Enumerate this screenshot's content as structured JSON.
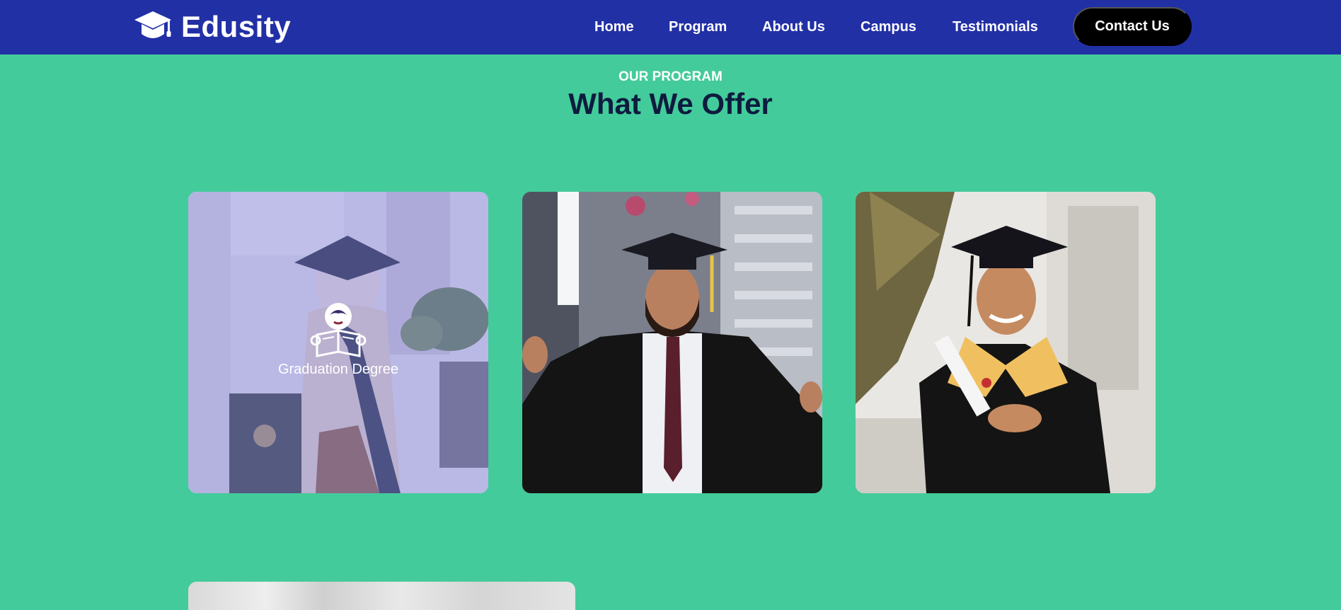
{
  "brand": {
    "name": "Edusity"
  },
  "nav": {
    "items": [
      {
        "label": "Home"
      },
      {
        "label": "Program"
      },
      {
        "label": "About Us"
      },
      {
        "label": "Campus"
      },
      {
        "label": "Testimonials"
      }
    ],
    "contact_label": "Contact Us"
  },
  "section": {
    "subtitle": "OUR PROGRAM",
    "title": "What We Offer"
  },
  "programs": [
    {
      "caption": "Graduation Degree",
      "icon": "graduation-reader-icon",
      "hovered": true
    },
    {
      "caption": "",
      "icon": "",
      "hovered": false
    },
    {
      "caption": "",
      "icon": "",
      "hovered": false
    }
  ],
  "colors": {
    "navbar": "#2230a6",
    "background": "#44cb9b",
    "title": "#0d1b3e",
    "contact_button": "#000000"
  }
}
